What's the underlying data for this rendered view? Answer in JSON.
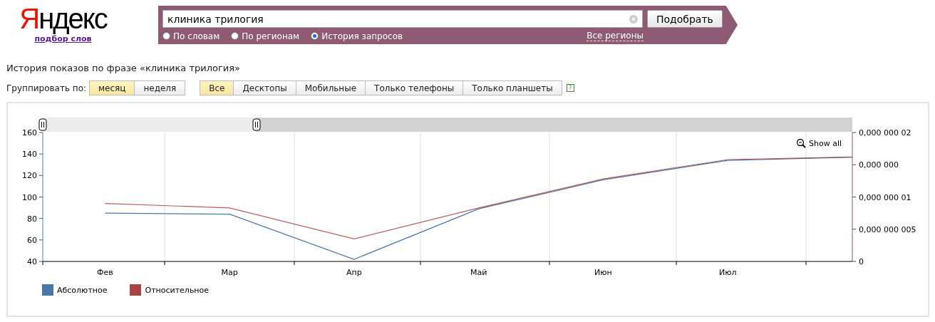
{
  "logo": {
    "text": "Яндекс",
    "subtitle": "подбор слов"
  },
  "search": {
    "value": "клиника трилогия",
    "button": "Подобрать",
    "modes": [
      {
        "label": "По словам",
        "selected": false
      },
      {
        "label": "По регионам",
        "selected": false
      },
      {
        "label": "История запросов",
        "selected": true
      }
    ],
    "regions_link": "Все регионы"
  },
  "heading": "История показов по фразе «клиника трилогия»",
  "group_by": {
    "label": "Группировать по:",
    "options": [
      {
        "label": "месяц",
        "selected": true
      },
      {
        "label": "неделя",
        "selected": false
      }
    ]
  },
  "devices": [
    {
      "label": "Все",
      "selected": true
    },
    {
      "label": "Десктопы",
      "selected": false
    },
    {
      "label": "Мобильные",
      "selected": false
    },
    {
      "label": "Только телефоны",
      "selected": false
    },
    {
      "label": "Только планшеты",
      "selected": false
    }
  ],
  "help": "?",
  "chart": {
    "show_all": "Show all",
    "chart_data": {
      "type": "line",
      "categories": [
        "Фев",
        "Мар",
        "Апр",
        "Май",
        "Июн",
        "Июл",
        null
      ],
      "ylim": [
        40,
        160
      ],
      "yticks": [
        40,
        60,
        80,
        100,
        120,
        140,
        160
      ],
      "y2lim": [
        0,
        2e-08
      ],
      "y2ticks": [
        {
          "value": 2e-08,
          "label": "0,000 000 02"
        },
        {
          "value": 1.5e-08,
          "label": "0,000 000"
        },
        {
          "value": 1e-08,
          "label": "0,000 000 01"
        },
        {
          "value": 5e-09,
          "label": "0,000 000 005"
        },
        {
          "value": 0,
          "label": "0"
        }
      ],
      "series": [
        {
          "name": "Абсолютное",
          "color": "#4a76a8",
          "values": [
            85,
            84,
            42,
            89,
            116,
            134,
            137
          ]
        },
        {
          "name": "Относительное",
          "color": "#a84444",
          "axis": "y2",
          "values": [
            9e-09,
            8.3e-09,
            3.5e-09,
            8.3e-09,
            1.28e-08,
            1.58e-08,
            1.62e-08
          ]
        }
      ]
    }
  }
}
